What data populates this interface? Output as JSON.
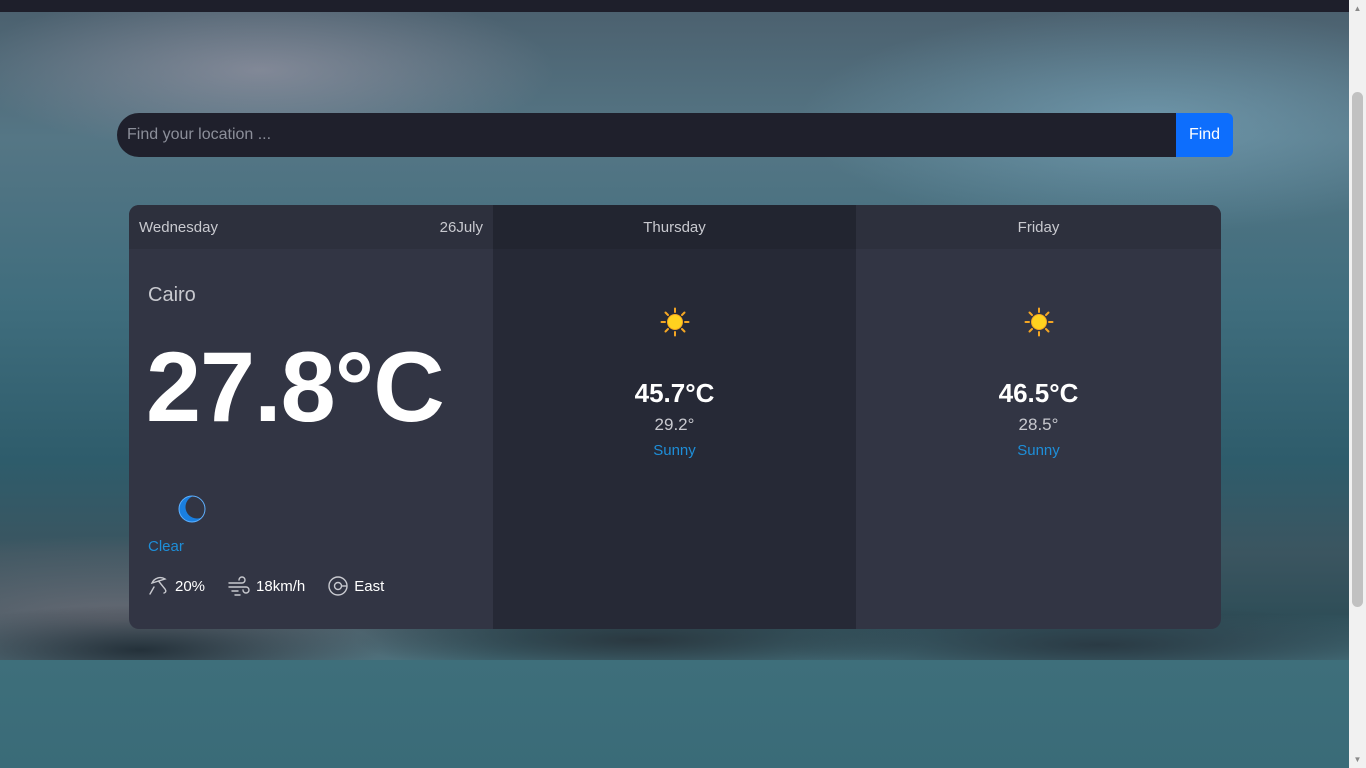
{
  "search": {
    "placeholder": "Find your location ...",
    "button_label": "Find"
  },
  "today": {
    "day": "Wednesday",
    "date": "26July",
    "city": "Cairo",
    "temp": "27.8°C",
    "condition": "Clear",
    "condition_icon": "moon-icon",
    "humidity": "20%",
    "wind_speed": "18km/h",
    "wind_direction": "East"
  },
  "forecast": [
    {
      "day": "Thursday",
      "max": "45.7°C",
      "min": "29.2°",
      "condition": "Sunny",
      "icon": "sun-icon"
    },
    {
      "day": "Friday",
      "max": "46.5°C",
      "min": "28.5°",
      "condition": "Sunny",
      "icon": "sun-icon"
    }
  ],
  "colors": {
    "accent": "#0d6efd",
    "condition_text": "#1e8ed8",
    "card_dark": "#262936",
    "card_light": "#323544"
  }
}
